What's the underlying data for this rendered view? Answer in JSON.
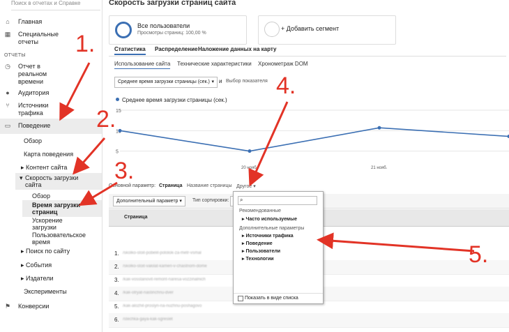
{
  "sidebar": {
    "search_placeholder": "Поиск в отчетах и Справке",
    "items": [
      {
        "label": "Главная",
        "icon": "home-icon"
      },
      {
        "label": "Специальные отчеты",
        "icon": "grid-icon"
      },
      {
        "label": "Отчет в реальном времени",
        "icon": "clock-icon"
      },
      {
        "label": "Аудитория",
        "icon": "person-icon"
      },
      {
        "label": "Источники трафика",
        "icon": "branch-icon"
      },
      {
        "label": "Поведение",
        "icon": "layout-icon"
      },
      {
        "label": "Конверсии",
        "icon": "flag-icon"
      }
    ],
    "section_reports": "ОТЧЕТЫ",
    "behavior_sub": {
      "overview": "Обзор",
      "behavior_map": "Карта поведения",
      "site_content": "Контент сайта",
      "site_speed": "Скорость загрузки сайта",
      "speed_overview": "Обзор",
      "page_timings": "Время загрузки страниц",
      "speed_suggestions": "Ускорение загрузки",
      "user_timings": "Пользовательское время",
      "site_search": "Поиск по сайту",
      "events": "События",
      "publishers": "Издатели",
      "experiments": "Эксперименты"
    }
  },
  "main": {
    "title": "Скорость загрузки страниц сайта",
    "segment": {
      "name": "Все пользователи",
      "detail": "Просмотры страниц: 100,00 %"
    },
    "add_segment": "+ Добавить сегмент",
    "tabs": [
      "Статистика",
      "Распределение",
      "Наложение данных на карту"
    ],
    "subtabs": [
      "Использование сайта",
      "Технические характеристики",
      "Хронометраж DOM"
    ],
    "metric_select": "Среднее время загрузки страницы (сек.)",
    "and_label": "и",
    "metric_chooser": "Выбор показателя",
    "dimension_label": "Основной параметр:",
    "dimension_active": "Страница",
    "dimension_alt": "Название страницы",
    "dimension_other": "Другое",
    "secondary_param": "Дополнительный параметр",
    "sort_type": "Тип сортировки:",
    "table_header": "Страница",
    "rows": [
      {
        "num": "1.",
        "url": "/skolko-stoit-pobelit-potolok-za-metr-vsmal"
      },
      {
        "num": "2.",
        "url": "/skolko-stoit-vakilat-kamen-v-chastnom-dome"
      },
      {
        "num": "3.",
        "url": "/kak-vosstanovit-remont-naresa-vozzinalnich"
      },
      {
        "num": "4.",
        "url": "/kak-otryat-nastinchnu-dver"
      },
      {
        "num": "5.",
        "url": "/kak-alozhit-proslyn-na-nuzhnu-poshagovo"
      },
      {
        "num": "6.",
        "url": "/stechka-gaya-kak-sgreslet"
      }
    ]
  },
  "dropdown": {
    "recommended_header": "Рекомендованные",
    "recommended_item": "Часто используемые",
    "extra_header": "Дополнительные параметры",
    "items": [
      "Источники трафика",
      "Поведение",
      "Пользователи",
      "Технологии"
    ],
    "footer": "Показать в виде списка"
  },
  "annotations": [
    "1.",
    "2.",
    "3.",
    "4.",
    "5."
  ],
  "chart_data": {
    "type": "line",
    "series": [
      {
        "name": "Среднее время загрузки страницы (сек.)",
        "values": [
          10,
          5,
          10.7,
          8.6
        ]
      }
    ],
    "categories": [
      "",
      "20 нояб.",
      "21 нояб.",
      ""
    ],
    "y_ticks": [
      "15",
      "10",
      "5"
    ],
    "ylim": [
      0,
      15
    ],
    "color": "#3b6fb3",
    "grid": true
  },
  "colors": {
    "accent": "#3b6fb3",
    "annotation": "#e23326",
    "highlight": "#ececec"
  }
}
